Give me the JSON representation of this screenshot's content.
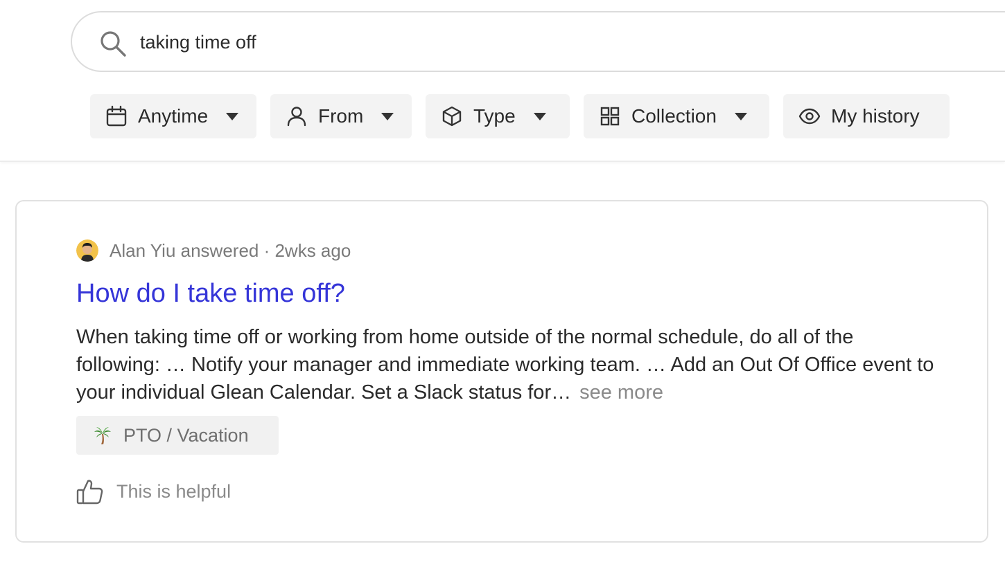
{
  "search": {
    "query": "taking time off",
    "icon": "search-icon"
  },
  "filters": [
    {
      "label": "Anytime",
      "icon": "calendar-icon",
      "has_dropdown": true
    },
    {
      "label": "From",
      "icon": "person-icon",
      "has_dropdown": true
    },
    {
      "label": "Type",
      "icon": "cube-icon",
      "has_dropdown": true
    },
    {
      "label": "Collection",
      "icon": "grid-icon",
      "has_dropdown": true
    },
    {
      "label": "My history",
      "icon": "eye-icon",
      "has_dropdown": false
    }
  ],
  "result": {
    "meta": "Alan Yiu answered · 2wks ago",
    "title": "How do I take time off?",
    "snippet": "When taking time off or working from home outside of the normal schedule, do all of the following: … Notify your manager and immediate working team. … Add an Out Of Office event to your individual Glean Calendar. Set a Slack status for…",
    "see_more": "see more",
    "tag": {
      "label": "PTO / Vacation",
      "icon": "palm-tree-icon"
    },
    "helpful_label": "This is helpful"
  },
  "colors": {
    "title_link": "#3535d8",
    "filter_bg": "#f3f3f3",
    "tag_bg": "#f1f1f1",
    "muted_text": "#7a7a7a",
    "border": "#e1e1e1"
  }
}
